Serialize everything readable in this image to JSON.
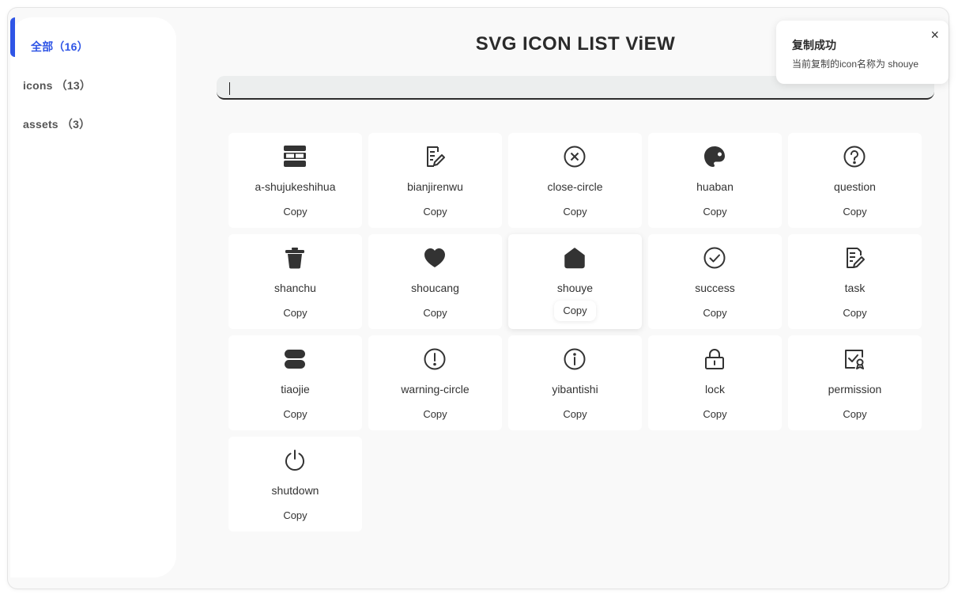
{
  "title": "SVG ICON LIST ViEW",
  "sidebar": {
    "items": [
      {
        "label": "全部（16）",
        "active": true
      },
      {
        "label": "icons （13）",
        "active": false
      },
      {
        "label": "assets （3）",
        "active": false
      }
    ]
  },
  "search": {
    "value": "",
    "placeholder": ""
  },
  "icons": [
    {
      "name": "a-shujukeshihua",
      "copy": "Copy",
      "icon": "dashboard-icon"
    },
    {
      "name": "bianjirenwu",
      "copy": "Copy",
      "icon": "edit-task-icon"
    },
    {
      "name": "close-circle",
      "copy": "Copy",
      "icon": "close-circle-icon"
    },
    {
      "name": "huaban",
      "copy": "Copy",
      "icon": "palette-icon"
    },
    {
      "name": "question",
      "copy": "Copy",
      "icon": "question-icon"
    },
    {
      "name": "shanchu",
      "copy": "Copy",
      "icon": "trash-icon"
    },
    {
      "name": "shoucang",
      "copy": "Copy",
      "icon": "heart-icon"
    },
    {
      "name": "shouye",
      "copy": "Copy",
      "icon": "home-icon"
    },
    {
      "name": "success",
      "copy": "Copy",
      "icon": "check-circle-icon"
    },
    {
      "name": "task",
      "copy": "Copy",
      "icon": "task-icon"
    },
    {
      "name": "tiaojie",
      "copy": "Copy",
      "icon": "adjust-icon"
    },
    {
      "name": "warning-circle",
      "copy": "Copy",
      "icon": "warning-circle-icon"
    },
    {
      "name": "yibantishi",
      "copy": "Copy",
      "icon": "info-circle-icon"
    },
    {
      "name": "lock",
      "copy": "Copy",
      "icon": "lock-icon"
    },
    {
      "name": "permission",
      "copy": "Copy",
      "icon": "permission-icon"
    },
    {
      "name": "shutdown",
      "copy": "Copy",
      "icon": "power-icon"
    }
  ],
  "toast": {
    "title": "复制成功",
    "message": "当前复制的icon名称为 shouye",
    "close": "×"
  },
  "colors": {
    "accent": "#2f55e6",
    "icon": "#333333",
    "background": "#f9f9f9"
  }
}
